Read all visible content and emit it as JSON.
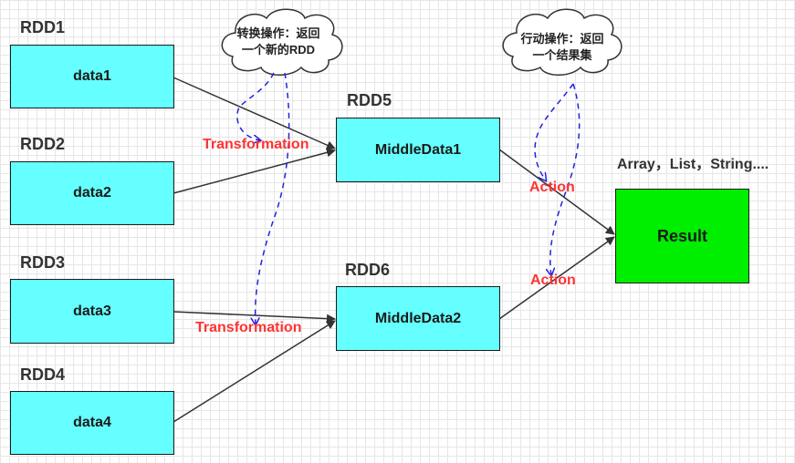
{
  "sources": [
    {
      "rdd": "RDD1",
      "data": "data1"
    },
    {
      "rdd": "RDD2",
      "data": "data2"
    },
    {
      "rdd": "RDD3",
      "data": "data3"
    },
    {
      "rdd": "RDD4",
      "data": "data4"
    }
  ],
  "middles": [
    {
      "rdd": "RDD5",
      "data": "MiddleData1"
    },
    {
      "rdd": "RDD6",
      "data": "MiddleData2"
    }
  ],
  "result": {
    "label": "Result",
    "types": "Array，List，String...."
  },
  "transformations": [
    "Transformation",
    "Transformation"
  ],
  "actions": [
    "Action",
    "Action"
  ],
  "clouds": {
    "transform": {
      "line1": "转换操作：返回",
      "line2": "一个新的RDD"
    },
    "action": {
      "line1": "行动操作：返回",
      "line2": "一个结果集"
    }
  },
  "colors": {
    "box_fill": "#66ffff",
    "result_fill": "#00ee00",
    "label_red": "#ff3333",
    "dashed_blue": "#2222dd"
  }
}
